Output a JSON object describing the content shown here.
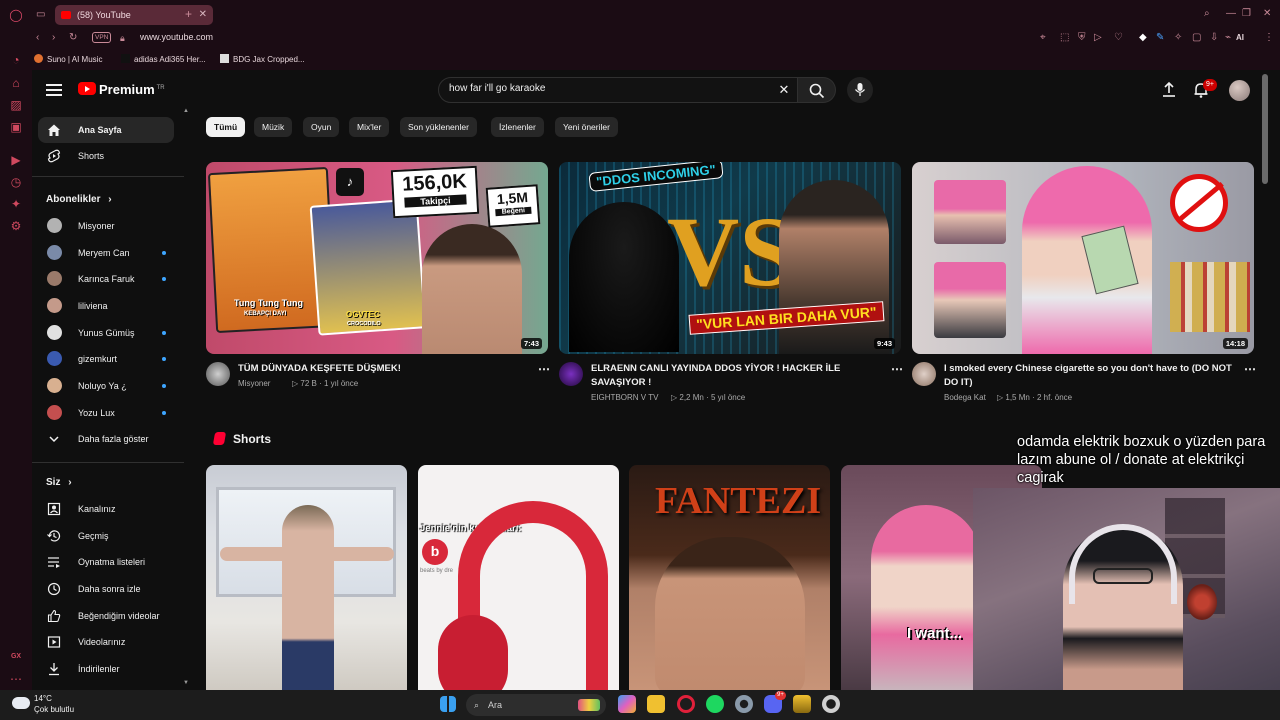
{
  "browser": {
    "tab_title": "(58) YouTube",
    "url": "www.youtube.com",
    "vpn_label": "VPN",
    "ai_label": "AI",
    "bookmarks": [
      "Suno | AI Music",
      "adidas Adi365 Her...",
      "BDG Jax Cropped..."
    ]
  },
  "youtube": {
    "logo": "Premium",
    "logo_region": "TR",
    "search": {
      "value": "how far i'll go karaoke",
      "placeholder": "Ara"
    },
    "notification_count": "9+",
    "chips": [
      "Tümü",
      "Müzik",
      "Oyun",
      "Mix'ler",
      "Son yüklenenler",
      "İzlenenler",
      "Yeni öneriler"
    ],
    "sidebar": {
      "main": [
        {
          "label": "Ana Sayfa",
          "icon": "home-icon"
        },
        {
          "label": "Shorts",
          "icon": "shorts-icon"
        }
      ],
      "subscriptions_title": "Abonelikler",
      "subscriptions": [
        {
          "label": "Misyoner",
          "new": false,
          "color": "#b2b2b2"
        },
        {
          "label": "Meryem Can",
          "new": true,
          "color": "#7a8aa8"
        },
        {
          "label": "Karınca Faruk",
          "new": true,
          "color": "#9a7a6a"
        },
        {
          "label": "liliviena",
          "new": false,
          "color": "#c49a8a"
        },
        {
          "label": "Yunus Gümüş",
          "new": true,
          "color": "#e0e0e0"
        },
        {
          "label": "gizemkurt",
          "new": true,
          "color": "#3a5ab0"
        },
        {
          "label": "Noluyo Ya ¿",
          "new": true,
          "color": "#d8b090"
        },
        {
          "label": "Yozu Lux",
          "new": true,
          "color": "#c44f4f"
        }
      ],
      "show_more": "Daha fazla göster",
      "you_title": "Siz",
      "you": [
        {
          "label": "Kanalınız",
          "icon": "channel-icon"
        },
        {
          "label": "Geçmiş",
          "icon": "history-icon"
        },
        {
          "label": "Oynatma listeleri",
          "icon": "playlist-icon"
        },
        {
          "label": "Daha sonra izle",
          "icon": "watch-later-icon"
        },
        {
          "label": "Beğendiğim videolar",
          "icon": "like-icon"
        },
        {
          "label": "Videolarınız",
          "icon": "your-videos-icon"
        },
        {
          "label": "İndirilenler",
          "icon": "download-icon"
        }
      ]
    },
    "videos": [
      {
        "title": "TÜM DÜNYADA KEŞFETE DÜŞMEK!",
        "channel": "Misyoner",
        "views": "72 B",
        "age": "1 yıl önce",
        "duration": "7:43",
        "thumb_text": [
          "156,0K",
          "Takipçi",
          "1,5M",
          "Beğeni",
          "Tung Tung Tung",
          "KEBAPÇI DAYI",
          "OGVTEC",
          "CROCODILO"
        ]
      },
      {
        "title": "ELRAENN CANLI YAYINDA DDOS YİYOR !  HACKER İLE SAVAŞIYOR !",
        "channel": "EIGHTBORN V TV",
        "views": "2,2 Mn",
        "age": "5 yıl önce",
        "duration": "9:43",
        "thumb_text": [
          "\"DDOS INCOMING\"",
          "\"VUR LAN BIR DAHA VUR\""
        ]
      },
      {
        "title": "I smoked every Chinese cigarette so you don't have to (DO NOT DO IT)",
        "channel": "Bodega Kat",
        "views": "1,5 Mn",
        "age": "2 hf. önce",
        "duration": "14:18",
        "thumb_text": []
      }
    ],
    "shorts_title": "Shorts",
    "shorts_text": [
      "Jennie'nin kulaklıkları:",
      "beats by dre",
      "FANTEZI",
      "I want..."
    ]
  },
  "overlay_text": "odamda elektrik bozxuk o yüzden para lazım abune ol / donate at elektrikçi cagirak",
  "taskbar": {
    "temperature": "14°C",
    "weather": "Çok bulutlu",
    "search_placeholder": "Ara",
    "discord_badge": "9+"
  }
}
